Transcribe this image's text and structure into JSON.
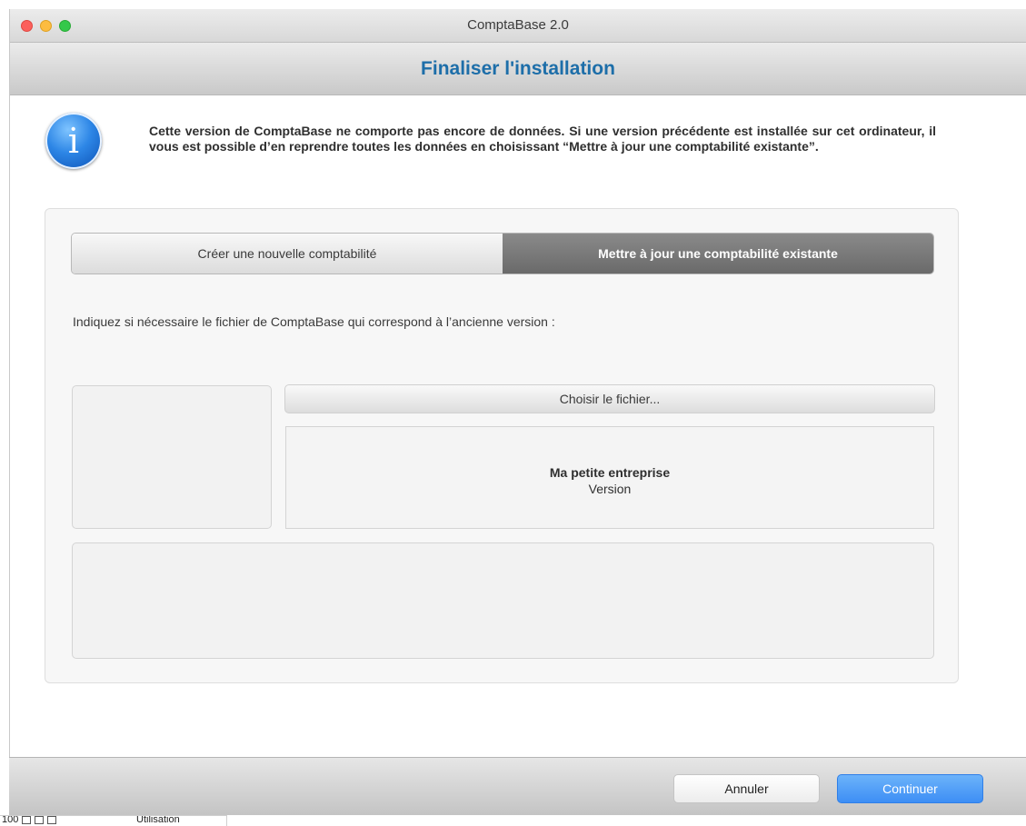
{
  "window": {
    "title": "ComptaBase 2.0"
  },
  "header": {
    "title": "Finaliser l'installation"
  },
  "intro": {
    "icon": "info-icon",
    "text": "Cette version de ComptaBase ne comporte pas encore de données. Si une version précédente est installée sur cet ordinateur, il vous est possible d’en reprendre toutes les données en choisissant “Mettre à jour une comptabilité existante”."
  },
  "tabs": [
    {
      "label": "Créer une nouvelle comptabilité",
      "selected": false
    },
    {
      "label": "Mettre à jour une comptabilité existante",
      "selected": true
    }
  ],
  "content": {
    "instruction": "Indiquez si nécessaire le fichier de ComptaBase qui correspond à l’ancienne version :",
    "choose_button": "Choisir le fichier...",
    "file_name": "Ma petite entreprise",
    "file_version": "Version"
  },
  "footer": {
    "cancel_label": "Annuler",
    "continue_label": "Continuer"
  },
  "bottom_strip": {
    "zoom": "100",
    "label": "Utilisation"
  },
  "colors": {
    "header_title": "#1d6ea9",
    "primary_button": "#3d8ef5"
  }
}
